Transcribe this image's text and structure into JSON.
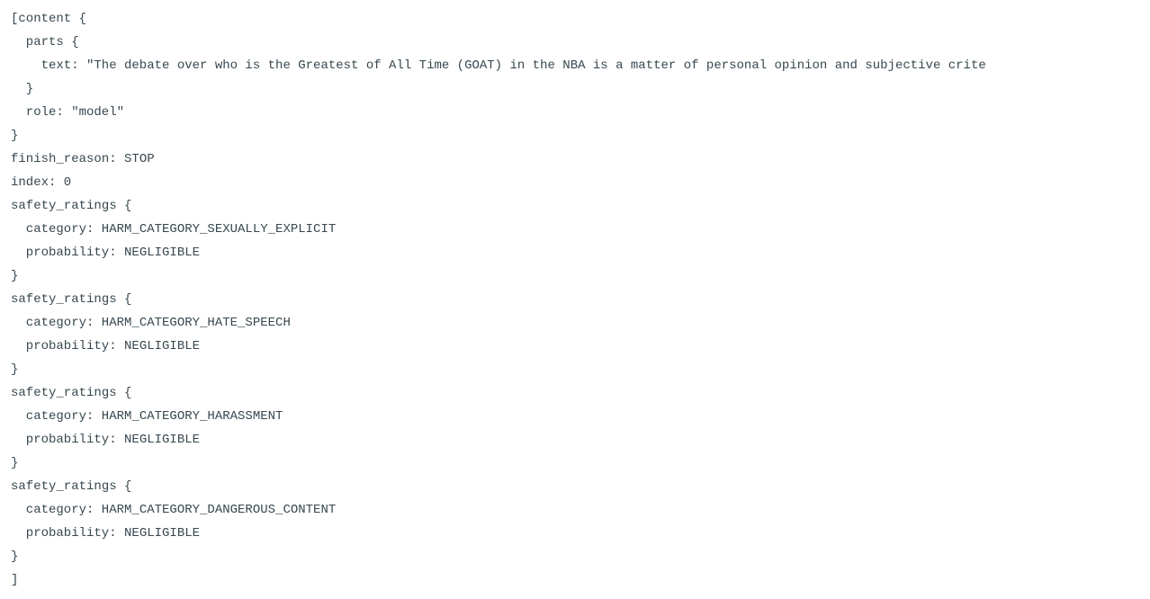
{
  "code": {
    "l1": "[content {",
    "l2": "parts {",
    "l3": "text: \"The debate over who is the Greatest of All Time (GOAT) in the NBA is a matter of personal opinion and subjective crite",
    "l4": "}",
    "l5": "role: \"model\"",
    "l6": "}",
    "l7": "finish_reason: STOP",
    "l8": "index: 0",
    "l9": "safety_ratings {",
    "l10": "category: HARM_CATEGORY_SEXUALLY_EXPLICIT",
    "l11": "probability: NEGLIGIBLE",
    "l12": "}",
    "l13": "safety_ratings {",
    "l14": "category: HARM_CATEGORY_HATE_SPEECH",
    "l15": "probability: NEGLIGIBLE",
    "l16": "}",
    "l17": "safety_ratings {",
    "l18": "category: HARM_CATEGORY_HARASSMENT",
    "l19": "probability: NEGLIGIBLE",
    "l20": "}",
    "l21": "safety_ratings {",
    "l22": "category: HARM_CATEGORY_DANGEROUS_CONTENT",
    "l23": "probability: NEGLIGIBLE",
    "l24": "}",
    "l25": "]"
  }
}
